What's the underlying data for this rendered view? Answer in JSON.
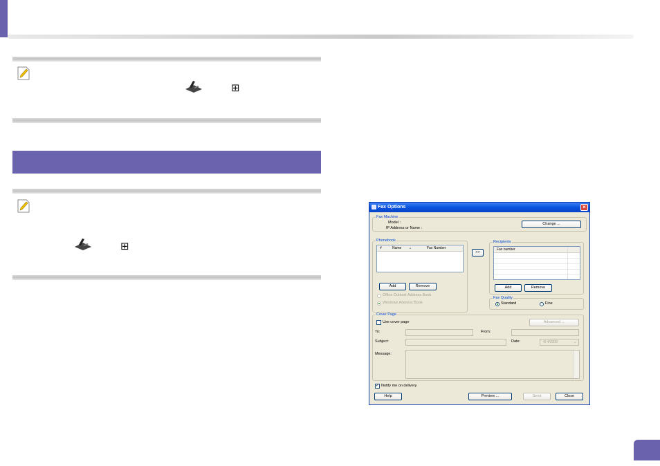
{
  "dialog": {
    "title": "Fax Options",
    "close": "×",
    "fax_machine": {
      "group": "Fax Machine",
      "model_label": "Model :",
      "ip_label": "IP Address or Name :",
      "change_button": "Change ..."
    },
    "phonebook": {
      "group": "Phonebook",
      "columns": [
        "#",
        "Name",
        "Fax Number"
      ],
      "sort_glyph": "▲",
      "add": "Add",
      "remove": "Remove",
      "outlook": "Office Outlook Address Book",
      "windows": "Windows Address Book"
    },
    "transfer_button": ">>",
    "recipients": {
      "group": "Recipients",
      "column": "Fax number",
      "add": "Add",
      "remove": "Remove"
    },
    "fax_quality": {
      "group": "Fax Quality",
      "standard": "Standard",
      "fine": "Fine",
      "selected": "Standard"
    },
    "cover_page": {
      "group": "Cover Page",
      "use_cover": "Use cover page",
      "advanced": "Advanced ...",
      "to": "To:",
      "from": "From:",
      "subject": "Subject:",
      "date": "Date:",
      "date_value": "4/ 4/2009",
      "message": "Message:"
    },
    "notify": "Notify me on delivery",
    "notify_checked": true,
    "help": "Help",
    "preview": "Preview ...",
    "send": "Send",
    "close_button": "Close"
  },
  "icons": [
    "note-pencil-icon",
    "fax-machine-icon",
    "cover-page-icon"
  ],
  "colors": {
    "accent": "#6b63ad",
    "dialog_bg": "#ece9d8",
    "titlebar": "#0a55de"
  }
}
